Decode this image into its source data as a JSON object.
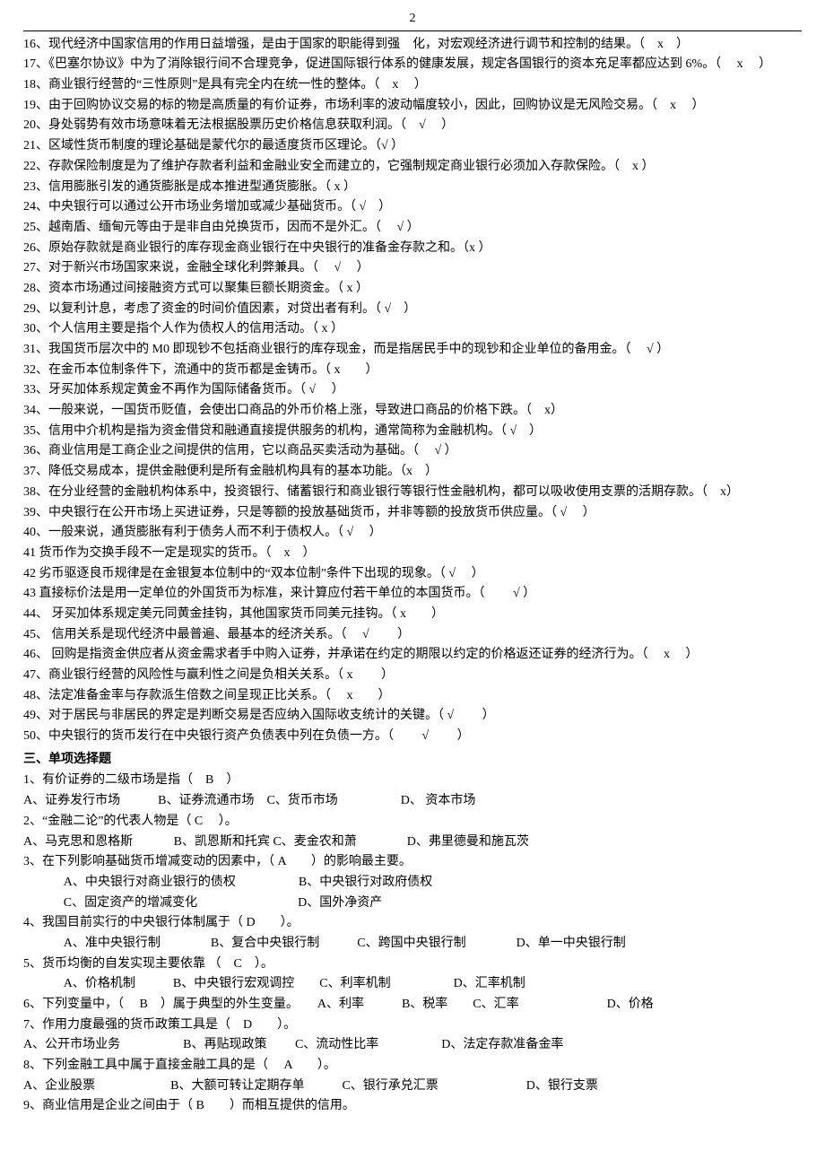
{
  "page_number": "2",
  "true_false": [
    {
      "n": "16",
      "text": "现代经济中国家信用的作用日益增强，是由于国家的职能得到强　化，对宏观经济进行调节和控制的结果。（　x　）"
    },
    {
      "n": "17",
      "text": "《巴塞尔协议》中为了消除银行间不合理竞争，促进国际银行体系的健康发展，规定各国银行的资本充足率都应达到 6%。（　 x 　）"
    },
    {
      "n": "18",
      "text": "商业银行经营的“三性原则”是具有完全内在统一性的整体。（　x　 ）"
    },
    {
      "n": "19",
      "text": "由于回购协议交易的标的物是高质量的有价证券，市场利率的波动幅度较小，因此，回购协议是无风险交易。（　x　 ）"
    },
    {
      "n": "20",
      "text": "身处弱势有效市场意味着无法根据股票历史价格信息获取利润。（　√　 ）"
    },
    {
      "n": "21",
      "text": "区域性货币制度的理论基础是蒙代尔的最适度货币区理论。（√ ）"
    },
    {
      "n": "22",
      "text": "存款保险制度是为了维护存款者利益和金融业安全而建立的，它强制规定商业银行必须加入存款保险。（　x ）"
    },
    {
      "n": "23",
      "text": "信用膨胀引发的通货膨胀是成本推进型通货膨胀。（ x ）"
    },
    {
      "n": "24",
      "text": "中央银行可以通过公开市场业务增加或减少基础货币。（ √　）"
    },
    {
      "n": "25",
      "text": "越南盾、缅甸元等由于是非自由兑换货币，因而不是外汇。（　 √ ）"
    },
    {
      "n": "26",
      "text": "原始存款就是商业银行的库存现金商业银行在中央银行的准备金存款之和。（x ）"
    },
    {
      "n": "27",
      "text": "对于新兴市场国家来说，金融全球化利弊兼具。（　 √ 　）"
    },
    {
      "n": "28",
      "text": "资本市场通过间接融资方式可以聚集巨额长期资金。（ x ）"
    },
    {
      "n": "29",
      "text": "以复利计息，考虑了资金的时间价值因素，对贷出者有利。（ √　）"
    },
    {
      "n": "30",
      "text": "个人信用主要是指个人作为债权人的信用活动。（ x ）"
    },
    {
      "n": "31",
      "text": "我国货币层次中的 M0 即现钞不包括商业银行的库存现金，而是指居民手中的现钞和企业单位的备用金。（　 √ ）"
    },
    {
      "n": "32",
      "text": "在金币本位制条件下，流通中的货币都是金铸币。（ x　　）"
    },
    {
      "n": "33",
      "text": "牙买加体系规定黄金不再作为国际储备货币。（ √ 　）"
    },
    {
      "n": "34",
      "text": "一般来说，一国货币贬值，会使出口商品的外币价格上涨，导致进口商品的价格下跌。（　x）"
    },
    {
      "n": "35",
      "text": "信用中介机构是指为资金借贷和融通直接提供服务的机构，通常简称为金融机构。（ √　）"
    },
    {
      "n": "36",
      "text": "商业信用是工商企业之间提供的信用，它以商品买卖活动为基础。（　 √ ）"
    },
    {
      "n": "37",
      "text": "降低交易成本，提供金融便利是所有金融机构具有的基本功能。（x　）"
    },
    {
      "n": "38",
      "text": "在分业经营的金融机构体系中，投资银行、储蓄银行和商业银行等银行性金融机构，都可以吸收使用支票的活期存款。（　x）"
    },
    {
      "n": "39",
      "text": "中央银行在公开市场上买进证券，只是等额的投放基础货币，并非等额的投放货币供应量。（ √ 　）"
    },
    {
      "n": "40",
      "text": "一般来说，通货膨胀有利于债务人而不利于债权人。（ √ 　）"
    },
    {
      "n": "41",
      "text": "货币作为交换手段不一定是现实的货币。（　x　）"
    },
    {
      "n": "42",
      "text": "劣币驱逐良币规律是在金银复本位制中的“双本位制”条件下出现的现象。（ √ 　）"
    },
    {
      "n": "43",
      "text": "直接标价法是用一定单位的外国货币为标准，来计算应付若干单位的本国货币。（　　 √ ）"
    },
    {
      "n": "44",
      "text": " 牙买加体系规定美元同黄金挂钩，其他国家货币同美元挂钩。（ x　　）"
    },
    {
      "n": "45",
      "text": " 信用关系是现代经济中最普遍、最基本的经济关系。（　 √ 　　）"
    },
    {
      "n": "46",
      "text": " 回购是指资金供应者从资金需求者手中购入证券，并承诺在约定的期限以约定的价格返还证券的经济行为。（　 x 　）"
    },
    {
      "n": "47",
      "text": "商业银行经营的风险性与赢利性之间是负相关关系。（ x 　　）"
    },
    {
      "n": "48",
      "text": "法定准备金率与存款派生倍数之间呈现正比关系。（　 x　　）"
    },
    {
      "n": "49",
      "text": "对于居民与非居民的界定是判断交易是否应纳入国际收支统计的关键。（ √ 　　）"
    },
    {
      "n": "50",
      "text": "中央银行的货币发行在中央银行资产负债表中列在负债一方。（　　 √ 　　）"
    }
  ],
  "section3_title": "三、单项选择题",
  "mc": [
    {
      "q": "1、有价证券的二级市场是指（　B　）",
      "opts": "A、证券发行市场　　　B、证券流通市场　C、货币市场　　　　　D、 资本市场"
    },
    {
      "q": "2、“金融二论”的代表人物是（ C　 ）。",
      "opts": "A、马克思和恩格斯　　　 B、凯恩斯和托宾 C、麦金农和萧　　　　D、弗里德曼和施瓦茨"
    },
    {
      "q": "3、在下列影响基础货币增减变动的因素中，（ A　　）的影响最主要。",
      "opts_lines": [
        "A、中央银行对商业银行的债权　　　　　B、中央银行对政府债权",
        "C、固定资产的增减变化　　　　　　　　D、国外净资产"
      ]
    },
    {
      "q": "4、我国目前实行的中央银行体制属于（ D　　）。",
      "opts_lines": [
        "A、准中央银行制　　　　B、复合中央银行制　　　C、跨国中央银行制　　　　D、单一中央银行制"
      ]
    },
    {
      "q": "5、货币均衡的自发实现主要依靠 （　C　）。",
      "opts_lines": [
        "A、价格机制　　　B、中央银行宏观调控　　C、利率机制　　　　　D、汇率机制"
      ]
    },
    {
      "q": "6、下列变量中，（　 B　）属于典型的外生变量。　　A、利率　　　B、税率　　C、汇率　　　　　　　D、价格"
    },
    {
      "q": "7、作用力度最强的货币政策工具是（　D　　）。",
      "opts": "A、公开市场业务　　　　　B、再贴现政策　　 C、流动性比率　　　　　D、法定存款准备金率"
    },
    {
      "q": "8、下列金融工具中属于直接金融工具的是（　 A　　）。",
      "opts": "A、企业股票　　　　　　B、大额可转让定期存单　　　C、银行承兑汇票　　　　　　　D、银行支票"
    },
    {
      "q": "9、商业信用是企业之间由于（ B　　）而相互提供的信用。"
    }
  ]
}
